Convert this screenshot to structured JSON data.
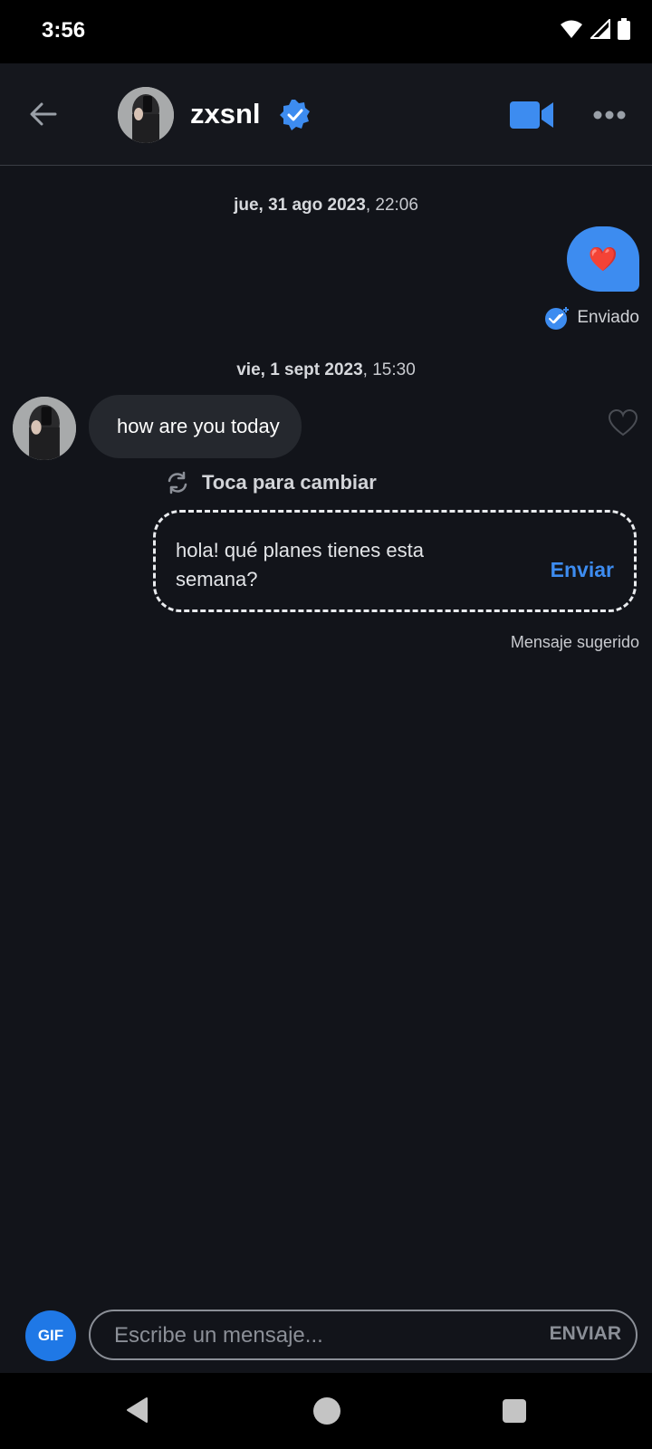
{
  "status_bar": {
    "time": "3:56",
    "icons": [
      "wifi-icon",
      "signal-icon",
      "battery-icon"
    ]
  },
  "header": {
    "username": "zxsnl",
    "icons": [
      "back-arrow-icon",
      "verified-badge-icon",
      "video-camera-icon",
      "more-options-icon"
    ]
  },
  "conversation": {
    "date_1": {
      "date": "jue, 31 ago 2023",
      "time": "22:06"
    },
    "sent_message": {
      "emoji": "❤️",
      "status": "Enviado"
    },
    "date_2": {
      "date": "vie, 1 sept 2023",
      "time": "15:30"
    },
    "received_message": {
      "text": "how are you today"
    }
  },
  "suggestion": {
    "swap_label": "Toca para cambiar",
    "text": "hola! qué planes tienes esta semana?",
    "send_label": "Enviar",
    "caption": "Mensaje sugerido"
  },
  "composer": {
    "gif_label": "GIF",
    "placeholder": "Escribe un mensaje...",
    "send_label": "ENVIAR"
  },
  "colors": {
    "accent": "#3d8cf0",
    "background": "#12141a",
    "incoming_bubble": "#25282e"
  }
}
